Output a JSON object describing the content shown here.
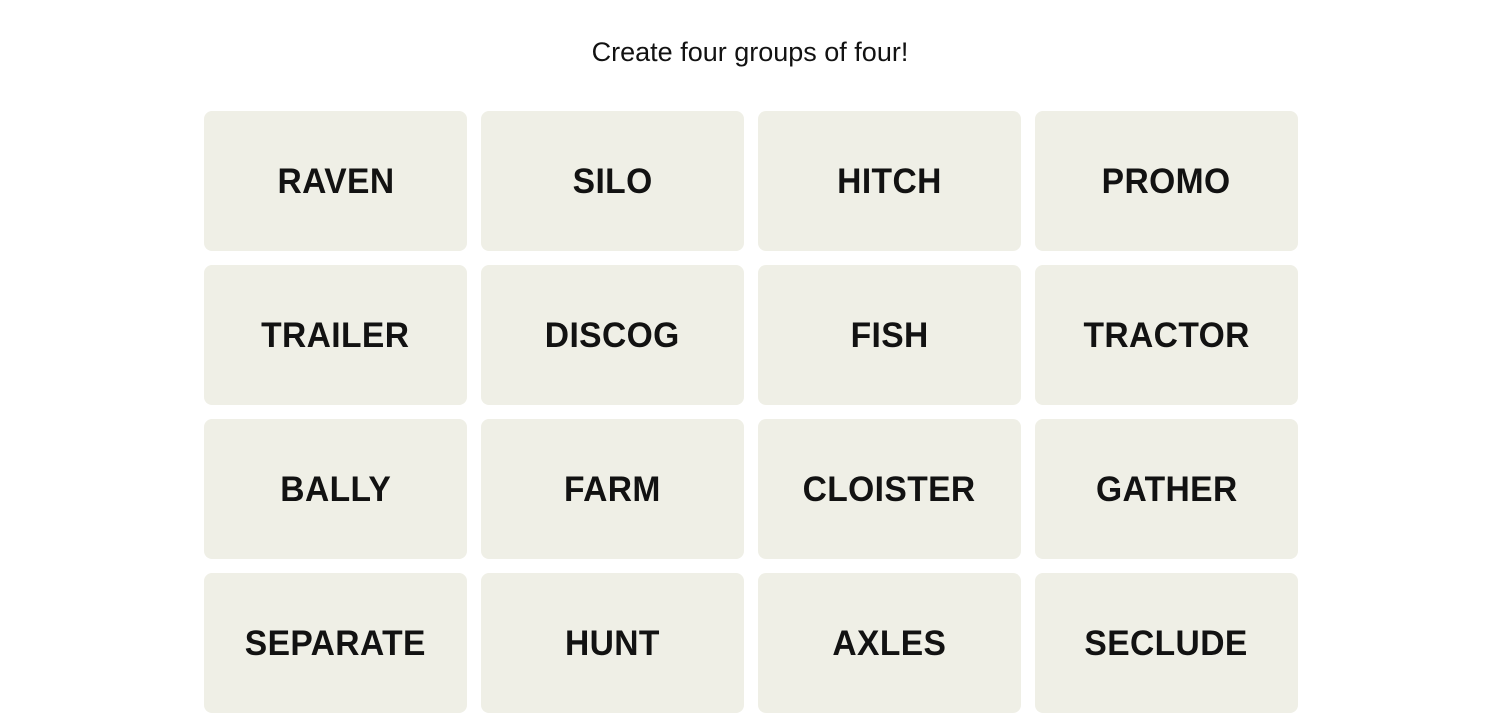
{
  "app": {
    "name": "Connections",
    "background_color": "#ffffff"
  },
  "header": {
    "instruction": "Create four groups of four!"
  },
  "board": {
    "rows": 4,
    "columns": 4,
    "tile_color": "#efefe6",
    "tile_text_color": "#121212",
    "tiles": [
      {
        "label": "RAVEN",
        "row": 1,
        "col": 1,
        "selected": false
      },
      {
        "label": "SILO",
        "row": 1,
        "col": 2,
        "selected": false
      },
      {
        "label": "HITCH",
        "row": 1,
        "col": 3,
        "selected": false
      },
      {
        "label": "PROMO",
        "row": 1,
        "col": 4,
        "selected": false
      },
      {
        "label": "TRAILER",
        "row": 2,
        "col": 1,
        "selected": false
      },
      {
        "label": "DISCOG",
        "row": 2,
        "col": 2,
        "selected": false
      },
      {
        "label": "FISH",
        "row": 2,
        "col": 3,
        "selected": false
      },
      {
        "label": "TRACTOR",
        "row": 2,
        "col": 4,
        "selected": false
      },
      {
        "label": "BALLY",
        "row": 3,
        "col": 1,
        "selected": false
      },
      {
        "label": "FARM",
        "row": 3,
        "col": 2,
        "selected": false
      },
      {
        "label": "CLOISTER",
        "row": 3,
        "col": 3,
        "selected": false
      },
      {
        "label": "GATHER",
        "row": 3,
        "col": 4,
        "selected": false
      },
      {
        "label": "SEPARATE",
        "row": 4,
        "col": 1,
        "selected": false
      },
      {
        "label": "HUNT",
        "row": 4,
        "col": 2,
        "selected": false
      },
      {
        "label": "AXLES",
        "row": 4,
        "col": 3,
        "selected": false
      },
      {
        "label": "SECLUDE",
        "row": 4,
        "col": 4,
        "selected": false
      }
    ]
  }
}
